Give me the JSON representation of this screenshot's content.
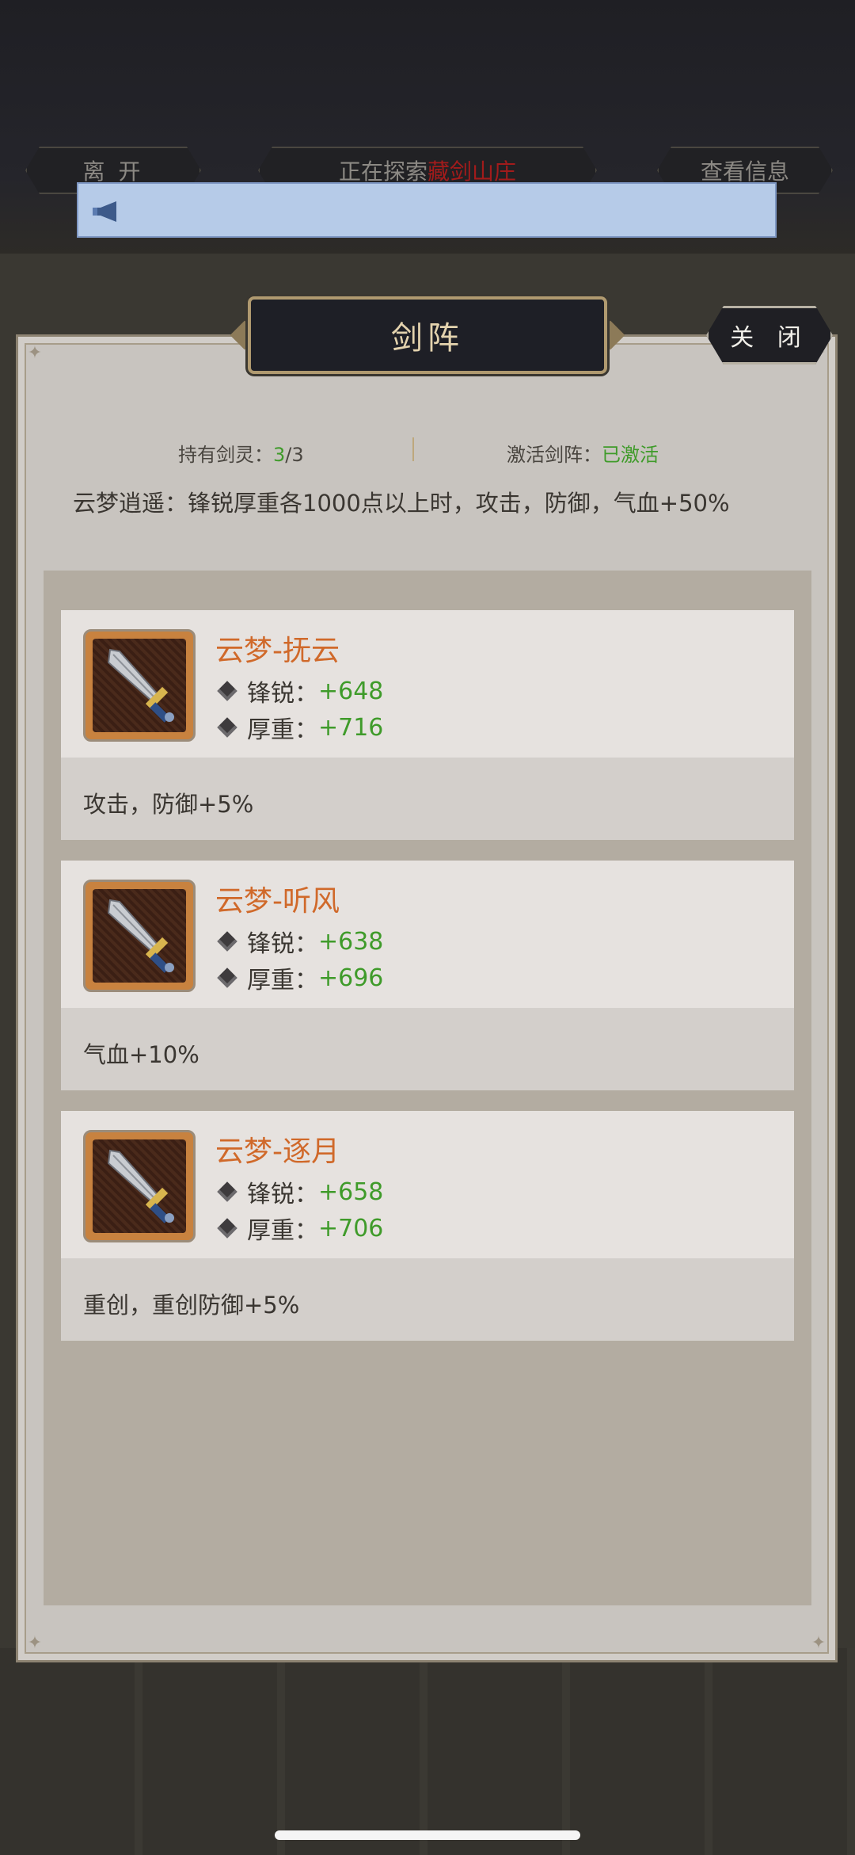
{
  "top_bar": {
    "leave_label": "离 开",
    "exploring_prefix": "正在探索",
    "exploring_location": "藏剑山庄",
    "view_info_label": "查看信息"
  },
  "panel": {
    "title": "剑阵",
    "close_label": "关 闭",
    "held_label": "持有剑灵：",
    "held_current": "3",
    "held_total": "/3",
    "activate_label": "激活剑阵：",
    "activate_status": "已激活",
    "set_description": "云梦逍遥：锋锐厚重各1000点以上时，攻击，防御，气血+50%"
  },
  "cards": [
    {
      "name": "云梦-抚云",
      "sharp_label": "锋锐：",
      "sharp_value": "+648",
      "heavy_label": "厚重：",
      "heavy_value": "+716",
      "effect": "攻击，防御+5%"
    },
    {
      "name": "云梦-听风",
      "sharp_label": "锋锐：",
      "sharp_value": "+638",
      "heavy_label": "厚重：",
      "heavy_value": "+696",
      "effect": "气血+10%"
    },
    {
      "name": "云梦-逐月",
      "sharp_label": "锋锐：",
      "sharp_value": "+658",
      "heavy_label": "厚重：",
      "heavy_value": "+706",
      "effect": "重创，重创防御+5%"
    }
  ],
  "icons": {
    "notice": "horn-icon",
    "item": "sword-icon",
    "stat": "diamond-icon"
  },
  "colors": {
    "item_name": "#d0692a",
    "stat_value": "#3f9b2a",
    "location": "#a21b1b"
  }
}
